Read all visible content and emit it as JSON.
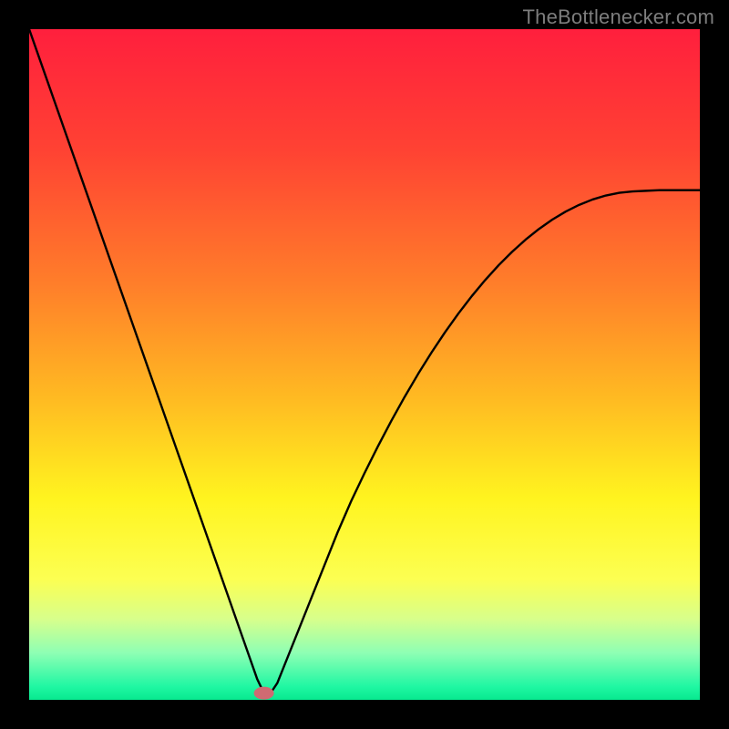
{
  "watermark": "TheBottlenecker.com",
  "chart_data": {
    "type": "line",
    "title": "",
    "xlabel": "",
    "ylabel": "",
    "xlim": [
      0,
      100
    ],
    "ylim": [
      0,
      100
    ],
    "x": [
      0,
      2,
      4,
      6,
      8,
      10,
      12,
      14,
      16,
      18,
      20,
      22,
      24,
      26,
      28,
      30,
      32,
      34,
      35,
      36,
      37,
      38,
      40,
      42,
      44,
      46,
      48,
      50,
      52,
      54,
      56,
      58,
      60,
      62,
      64,
      66,
      68,
      70,
      72,
      74,
      76,
      78,
      80,
      82,
      84,
      86,
      88,
      90,
      92,
      94,
      96,
      98,
      100
    ],
    "values": [
      100,
      94.3,
      88.6,
      82.9,
      77.2,
      71.5,
      65.8,
      60.1,
      54.4,
      48.7,
      43.0,
      37.3,
      31.6,
      25.9,
      20.2,
      14.5,
      8.8,
      3.1,
      1.0,
      1.0,
      2.5,
      5.0,
      10.0,
      15.0,
      20.0,
      25.0,
      29.6,
      33.8,
      37.8,
      41.6,
      45.2,
      48.6,
      51.8,
      54.8,
      57.6,
      60.2,
      62.6,
      64.8,
      66.8,
      68.6,
      70.2,
      71.6,
      72.8,
      73.8,
      74.6,
      75.2,
      75.6,
      75.8,
      75.9,
      76.0,
      76.0,
      76.0,
      76.0
    ],
    "marker": {
      "x": 35,
      "y": 1.0,
      "color": "#cf6a72"
    },
    "background_gradient_stops": [
      {
        "offset": 0.0,
        "color": "#ff1f3d"
      },
      {
        "offset": 0.18,
        "color": "#ff4233"
      },
      {
        "offset": 0.38,
        "color": "#ff7e2a"
      },
      {
        "offset": 0.55,
        "color": "#ffba22"
      },
      {
        "offset": 0.7,
        "color": "#fff41f"
      },
      {
        "offset": 0.82,
        "color": "#fcff52"
      },
      {
        "offset": 0.88,
        "color": "#d7ff8c"
      },
      {
        "offset": 0.93,
        "color": "#8effb4"
      },
      {
        "offset": 0.98,
        "color": "#20f7a3"
      },
      {
        "offset": 1.0,
        "color": "#08e98f"
      }
    ],
    "line_color": "#000000"
  }
}
